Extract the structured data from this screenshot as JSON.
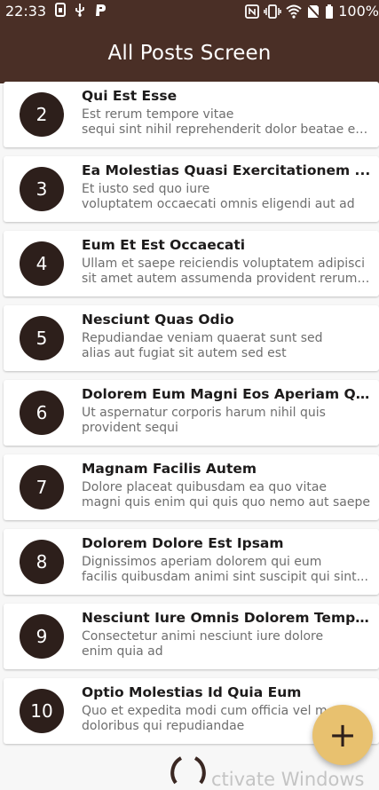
{
  "status_bar": {
    "time": "22:33",
    "battery": "100%",
    "left_icons": [
      "sim-card-icon",
      "usb-icon",
      "p-app-icon"
    ],
    "right_icons": [
      "nfc-icon",
      "vibrate-icon",
      "wifi-icon",
      "no-sim-icon",
      "battery-icon"
    ]
  },
  "app_bar": {
    "title": "All Posts Screen",
    "color": "#4a2f26"
  },
  "posts": [
    {
      "id": "2",
      "title": "Qui Est Esse",
      "line1": "Est rerum tempore vitae",
      "line2": "sequi sint nihil reprehenderit dolor beatae ea..."
    },
    {
      "id": "3",
      "title": "Ea Molestias Quasi Exercitationem ...",
      "line1": "Et iusto sed quo iure",
      "line2": "voluptatem occaecati omnis eligendi aut ad"
    },
    {
      "id": "4",
      "title": "Eum Et Est Occaecati",
      "line1": "Ullam et saepe reiciendis voluptatem adipisci",
      "line2": "sit amet autem assumenda provident rerum ..."
    },
    {
      "id": "5",
      "title": "Nesciunt Quas Odio",
      "line1": "Repudiandae veniam quaerat sunt sed",
      "line2": "alias aut fugiat sit autem sed est"
    },
    {
      "id": "6",
      "title": "Dolorem Eum Magni Eos Aperiam Quia",
      "line1": "Ut aspernatur corporis harum nihil quis",
      "line2": "provident sequi"
    },
    {
      "id": "7",
      "title": "Magnam Facilis Autem",
      "line1": "Dolore placeat quibusdam ea quo vitae",
      "line2": "magni quis enim qui quis quo nemo aut saepe"
    },
    {
      "id": "8",
      "title": "Dolorem Dolore Est Ipsam",
      "line1": "Dignissimos aperiam dolorem qui eum",
      "line2": "facilis quibusdam animi sint suscipit qui sint..."
    },
    {
      "id": "9",
      "title": "Nesciunt Iure Omnis Dolorem Tempora ...",
      "line1": "Consectetur animi nesciunt iure dolore",
      "line2": "enim quia ad"
    },
    {
      "id": "10",
      "title": "Optio Molestias Id Quia Eum",
      "line1": "Quo et expedita modi cum officia vel m",
      "line2": "doloribus qui repudiandae"
    }
  ],
  "fab": {
    "icon": "plus-icon",
    "label": "+",
    "color": "#e8c16f"
  },
  "watermark": "ctivate Windows"
}
